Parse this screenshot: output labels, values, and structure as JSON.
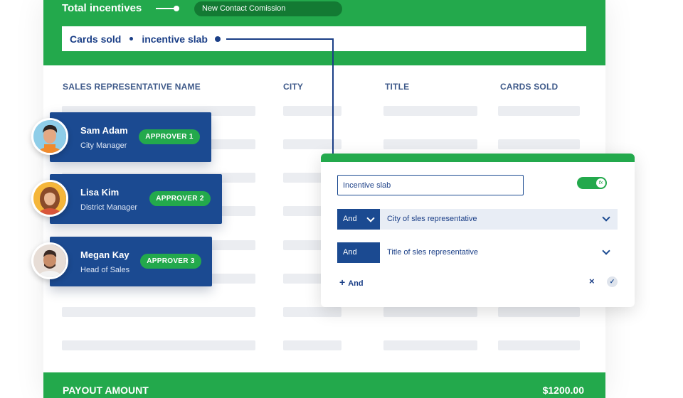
{
  "header": {
    "title": "Total incentives",
    "pill_label": "New  Contact Comission",
    "formula": {
      "term1": "Cards sold",
      "term2": "incentive slab"
    }
  },
  "table": {
    "columns": [
      "SALES REPRESENTATIVE NAME",
      "CITY",
      "TITLE",
      "CARDS SOLD"
    ]
  },
  "approvers": [
    {
      "name": "Sam Adam",
      "role": "City Manager",
      "badge": "APPROVER 1"
    },
    {
      "name": "Lisa Kim",
      "role": "District Manager",
      "badge": "APPROVER 2"
    },
    {
      "name": "Megan Kay",
      "role": "Head of Sales",
      "badge": "APPROVER 3"
    }
  ],
  "rule_panel": {
    "slab_value": "Incentive slab",
    "toggle_icon": "fx",
    "toggle_on": true,
    "conditions": [
      {
        "operator": "And",
        "field": "City of sles representative"
      },
      {
        "operator": "And",
        "field": "Title of sles representative"
      }
    ],
    "add_label": "And",
    "add_icon": "+",
    "close_icon": "×",
    "confirm_icon": "✓"
  },
  "footer": {
    "label": "PAYOUT AMOUNT",
    "amount": "$1200.00"
  },
  "colors": {
    "brand_green": "#23a94c",
    "dark_green": "#137a33",
    "navy": "#1b4a91",
    "text_navy": "#1b3f87",
    "skeleton": "#ebedf1"
  }
}
